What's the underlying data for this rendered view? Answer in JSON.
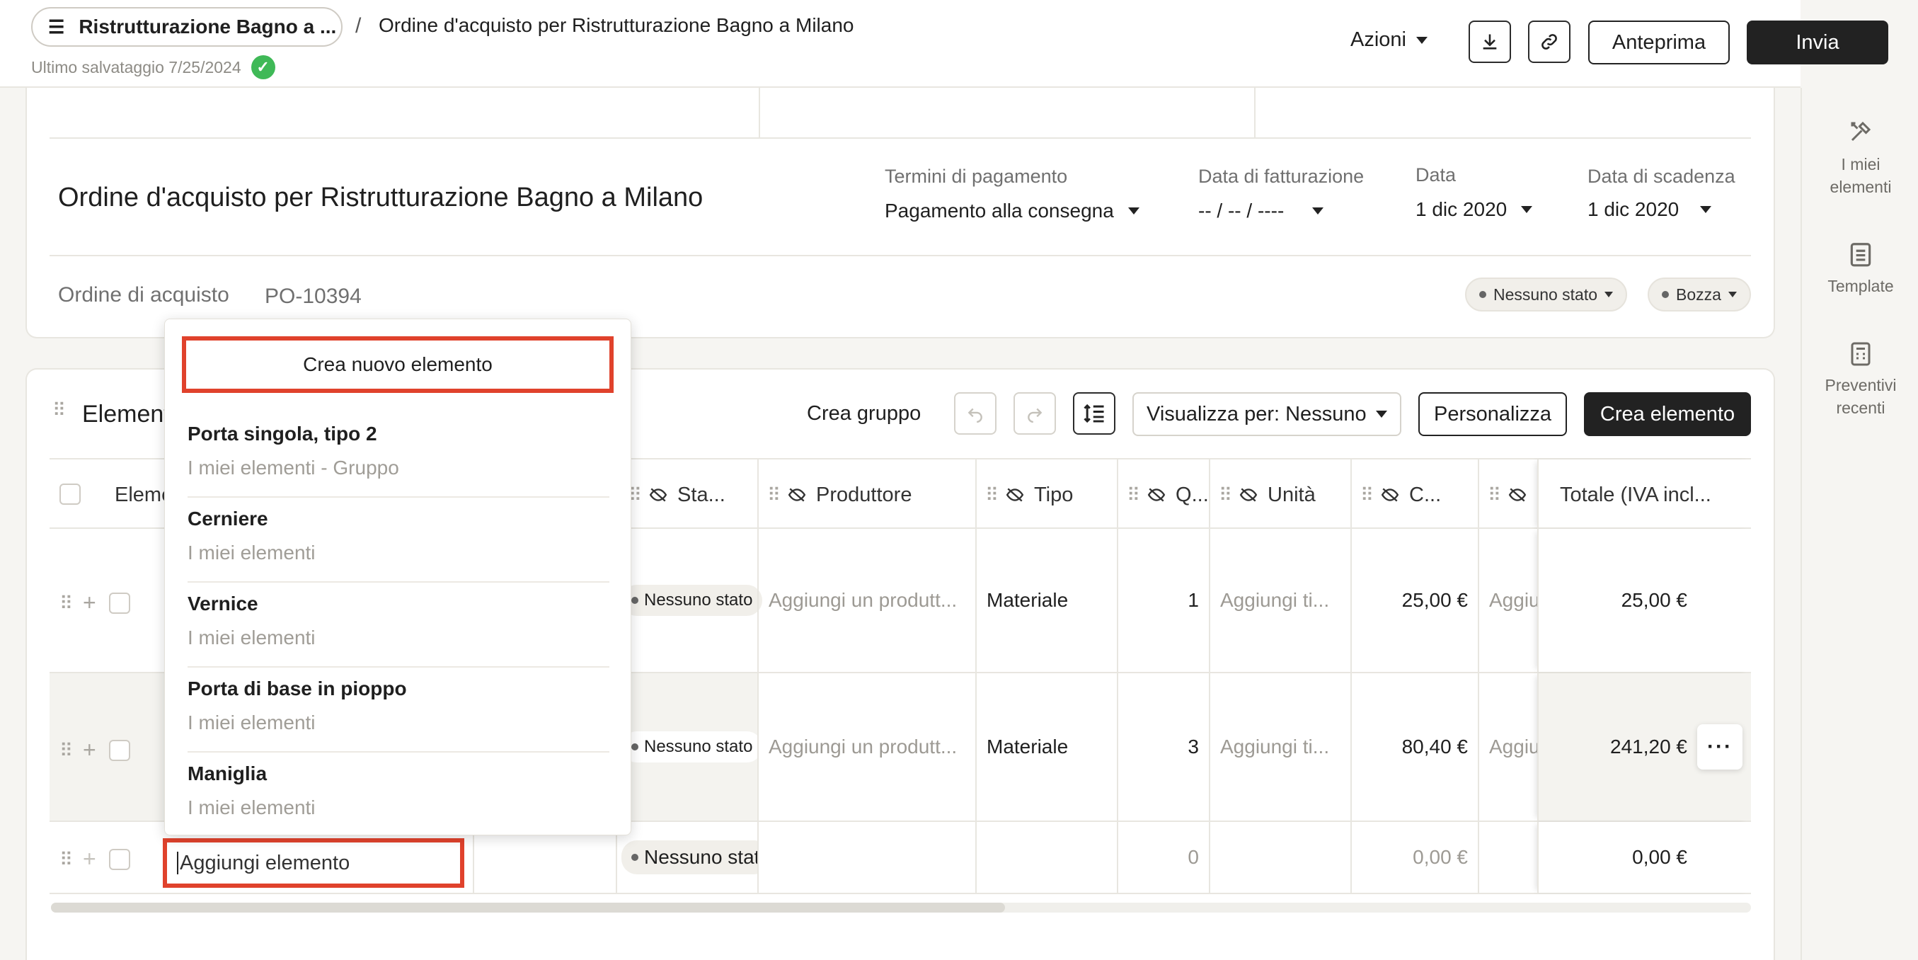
{
  "header": {
    "project_pill": "Ristrutturazione Bagno a ...",
    "separator": "/",
    "doc_title": "Ordine d'acquisto per Ristrutturazione Bagno a Milano",
    "last_saved": "Ultimo salvataggio 7/25/2024",
    "actions_label": "Azioni",
    "preview_label": "Anteprima",
    "send_label": "Invia"
  },
  "sidebar": {
    "items": [
      {
        "label": "I miei elementi",
        "icon": "tools-icon"
      },
      {
        "label": "Template",
        "icon": "clipboard-icon"
      },
      {
        "label": "Preventivi recenti",
        "icon": "calculator-icon"
      }
    ]
  },
  "order": {
    "title": "Ordine d'acquisto per Ristrutturazione Bagno a Milano",
    "payment_terms_label": "Termini di pagamento",
    "payment_terms_value": "Pagamento alla consegna",
    "invoice_date_label": "Data di fatturazione",
    "invoice_date_value": "-- / -- / ----",
    "date_label": "Data",
    "date_value": "1 dic 2020",
    "due_date_label": "Data di scadenza",
    "due_date_value": "1 dic 2020",
    "po_label": "Ordine di acquisto",
    "po_number": "PO-10394",
    "status_pill": "Nessuno stato",
    "draft_pill": "Bozza"
  },
  "items_section": {
    "title": "Elementi",
    "create_group": "Crea gruppo",
    "view_by": "Visualizza per: Nessuno",
    "customize": "Personalizza",
    "create_item": "Crea elemento"
  },
  "table": {
    "headers": {
      "element": "Eleme",
      "status": "Sta...",
      "producer": "Produttore",
      "type": "Tipo",
      "qty": "Q...",
      "unit": "Unità",
      "cost": "C...",
      "total": "Totale (IVA incl..."
    },
    "rows": [
      {
        "status": "Nessuno stato",
        "producer": "Aggiungi un produtt...",
        "type": "Materiale",
        "qty": "1",
        "unit": "Aggiungi ti...",
        "cost": "25,00 €",
        "extra": "Aggiu",
        "total": "25,00 €"
      },
      {
        "status": "Nessuno stato",
        "producer": "Aggiungi un produtt...",
        "type": "Materiale",
        "qty": "3",
        "unit": "Aggiungi ti...",
        "cost": "80,40 €",
        "extra": "Aggiu",
        "total": "241,20 €"
      },
      {
        "status": "Nessuno stat",
        "producer": "",
        "type": "",
        "qty": "0",
        "unit": "",
        "cost": "0,00 €",
        "extra": "",
        "total": "0,00 €"
      }
    ],
    "add_input_value": "Aggiungi elemento",
    "more_label": "···"
  },
  "dropdown": {
    "create_new": "Crea nuovo elemento",
    "items": [
      {
        "name": "Porta singola, tipo 2",
        "source": "I miei elementi - Gruppo"
      },
      {
        "name": "Cerniere",
        "source": "I miei elementi"
      },
      {
        "name": "Vernice",
        "source": "I miei elementi"
      },
      {
        "name": "Porta di base in pioppo",
        "source": "I miei elementi"
      },
      {
        "name": "Maniglia",
        "source": "I miei elementi"
      }
    ]
  },
  "colors": {
    "accent_dark": "#222222",
    "highlight": "#e0422c",
    "success": "#3fb957"
  }
}
